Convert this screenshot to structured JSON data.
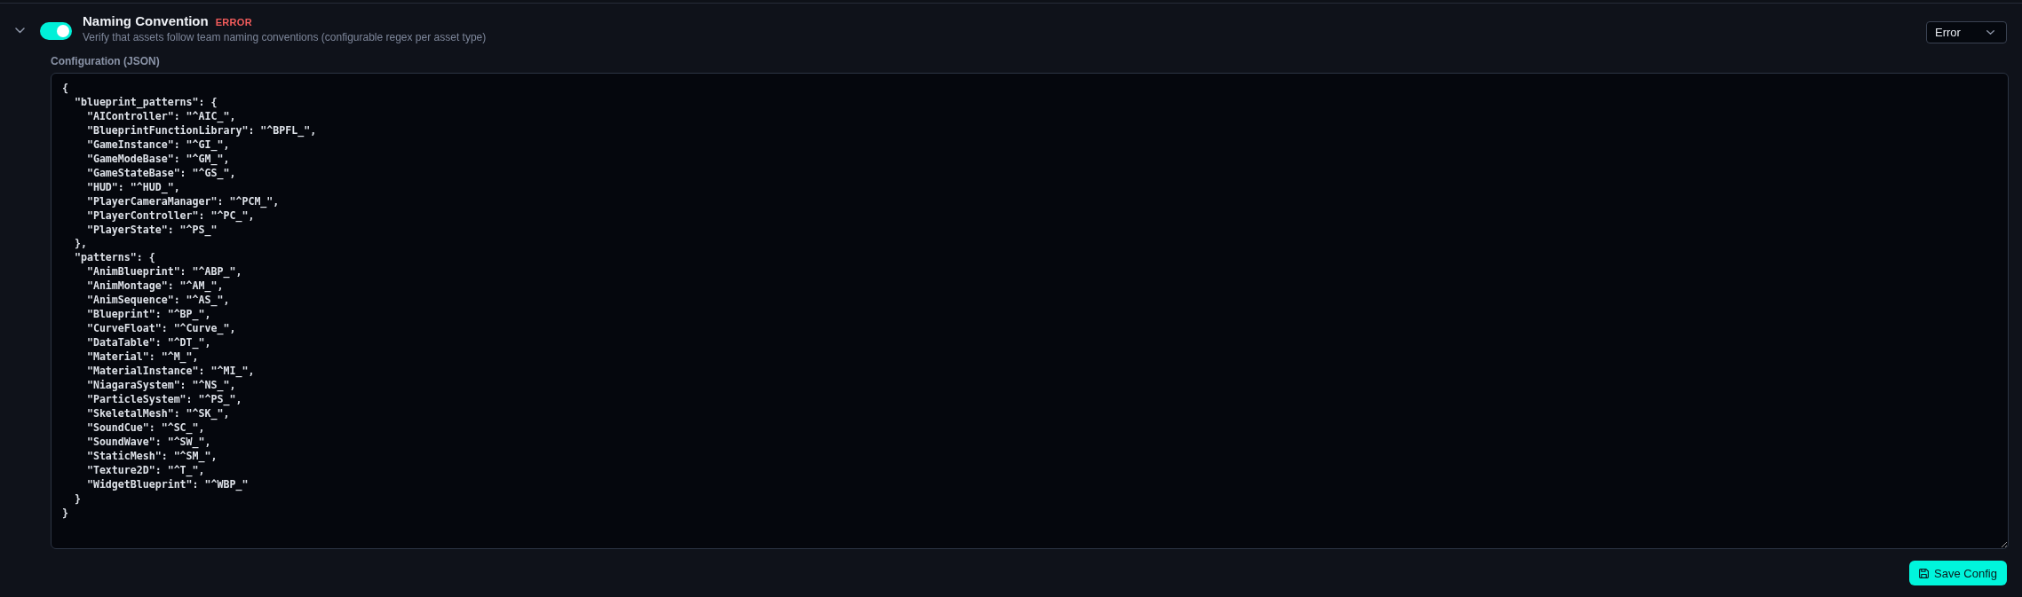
{
  "rule": {
    "expanded": true,
    "enabled": true,
    "title": "Naming Convention",
    "badge": "ERROR",
    "description": "Verify that assets follow team naming conventions (configurable regex per asset type)",
    "severity": "Error"
  },
  "config": {
    "label": "Configuration (JSON)",
    "value": "{\n  \"blueprint_patterns\": {\n    \"AIController\": \"^AIC_\",\n    \"BlueprintFunctionLibrary\": \"^BPFL_\",\n    \"GameInstance\": \"^GI_\",\n    \"GameModeBase\": \"^GM_\",\n    \"GameStateBase\": \"^GS_\",\n    \"HUD\": \"^HUD_\",\n    \"PlayerCameraManager\": \"^PCM_\",\n    \"PlayerController\": \"^PC_\",\n    \"PlayerState\": \"^PS_\"\n  },\n  \"patterns\": {\n    \"AnimBlueprint\": \"^ABP_\",\n    \"AnimMontage\": \"^AM_\",\n    \"AnimSequence\": \"^AS_\",\n    \"Blueprint\": \"^BP_\",\n    \"CurveFloat\": \"^Curve_\",\n    \"DataTable\": \"^DT_\",\n    \"Material\": \"^M_\",\n    \"MaterialInstance\": \"^MI_\",\n    \"NiagaraSystem\": \"^NS_\",\n    \"ParticleSystem\": \"^PS_\",\n    \"SkeletalMesh\": \"^SK_\",\n    \"SoundCue\": \"^SC_\",\n    \"SoundWave\": \"^SW_\",\n    \"StaticMesh\": \"^SM_\",\n    \"Texture2D\": \"^T_\",\n    \"WidgetBlueprint\": \"^WBP_\"\n  }\n}"
  },
  "save_button": {
    "label": "Save Config"
  }
}
